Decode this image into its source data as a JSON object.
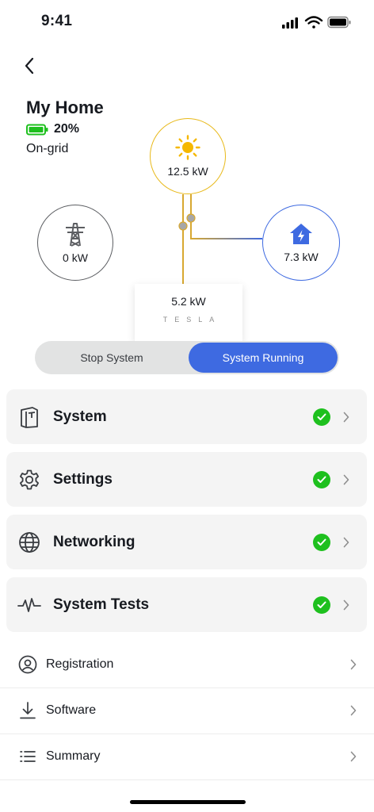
{
  "status_bar": {
    "time": "9:41"
  },
  "header": {
    "title": "My Home",
    "battery_percent": "20%",
    "grid_status": "On-grid"
  },
  "flow": {
    "solar": {
      "value": "12.5 kW",
      "icon": "sun-icon"
    },
    "grid": {
      "value": "0 kW",
      "icon": "power-tower-icon"
    },
    "home": {
      "value": "7.3 kW",
      "icon": "house-bolt-icon"
    },
    "powerwall": {
      "value": "5.2 kW",
      "brand": "TESLA"
    }
  },
  "toggle": {
    "stop_label": "Stop System",
    "run_label": "System Running",
    "active": "run"
  },
  "cards": [
    {
      "label": "System",
      "icon": "powerwall-icon",
      "status": "ok"
    },
    {
      "label": "Settings",
      "icon": "gear-icon",
      "status": "ok"
    },
    {
      "label": "Networking",
      "icon": "globe-icon",
      "status": "ok"
    },
    {
      "label": "System Tests",
      "icon": "pulse-icon",
      "status": "ok"
    }
  ],
  "rows": [
    {
      "label": "Registration",
      "icon": "user-circle-icon"
    },
    {
      "label": "Software",
      "icon": "download-icon"
    },
    {
      "label": "Summary",
      "icon": "list-icon"
    }
  ],
  "colors": {
    "solar": "#e8b91a",
    "grid": "#5c5e62",
    "home": "#3e6ae1",
    "accent": "#3e6ae1",
    "battery": "#1ec01e",
    "check": "#1ec01e"
  }
}
